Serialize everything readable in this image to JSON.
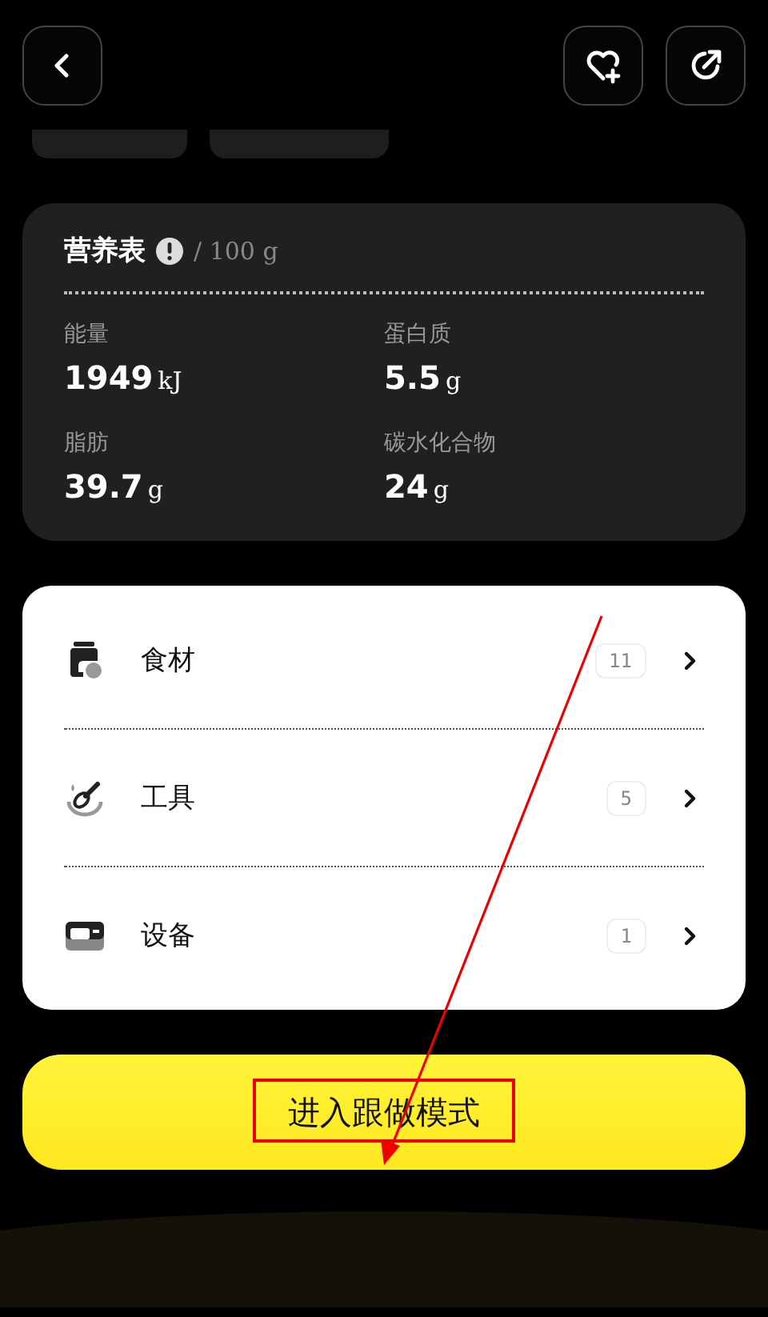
{
  "nutrition": {
    "title": "营养表",
    "per": "/ 100 g",
    "items": [
      {
        "label": "能量",
        "value": "1949",
        "unit": "kJ"
      },
      {
        "label": "蛋白质",
        "value": "5.5",
        "unit": "g"
      },
      {
        "label": "脂肪",
        "value": "39.7",
        "unit": "g"
      },
      {
        "label": "碳水化合物",
        "value": "24",
        "unit": "g"
      }
    ]
  },
  "sections": [
    {
      "kind": "ingredients",
      "label": "食材",
      "count": "11"
    },
    {
      "kind": "tools",
      "label": "工具",
      "count": "5"
    },
    {
      "kind": "appliances",
      "label": "设备",
      "count": "1"
    }
  ],
  "primary_button": "进入跟做模式"
}
